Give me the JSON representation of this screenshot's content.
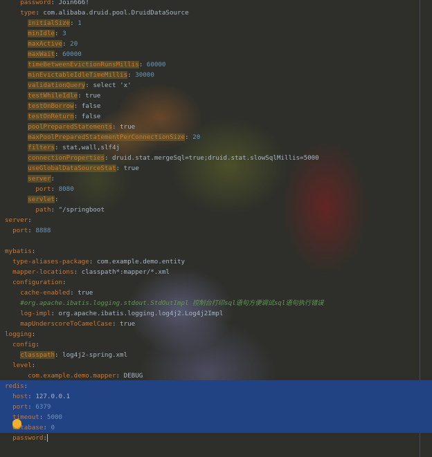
{
  "editor": {
    "lines": [
      {
        "indent": 4,
        "key": "password",
        "value": "Join666!"
      },
      {
        "indent": 4,
        "key": "type",
        "value": "com.alibaba.druid.pool.DruidDataSource"
      },
      {
        "indent": 6,
        "key": "initialSize",
        "value": "1"
      },
      {
        "indent": 6,
        "key": "minIdle",
        "value": "3"
      },
      {
        "indent": 6,
        "key": "maxActive",
        "value": "20"
      },
      {
        "indent": 6,
        "key": "maxWait",
        "value": "60000"
      },
      {
        "indent": 6,
        "key": "timeBetweenEvictionRunsMillis",
        "value": "60000"
      },
      {
        "indent": 6,
        "key": "minEvictableIdleTimeMillis",
        "value": "30000"
      },
      {
        "indent": 6,
        "key": "validationQuery",
        "value": "select 'x'"
      },
      {
        "indent": 6,
        "key": "testWhileIdle",
        "value": "true"
      },
      {
        "indent": 6,
        "key": "testOnBorrow",
        "value": "false"
      },
      {
        "indent": 6,
        "key": "testOnReturn",
        "value": "false"
      },
      {
        "indent": 6,
        "key": "poolPreparedStatements",
        "value": "true"
      },
      {
        "indent": 6,
        "key": "maxPoolPreparedStatementPerConnectionSize",
        "value": "20"
      },
      {
        "indent": 6,
        "key": "filters",
        "value": "stat,wall,slf4j"
      },
      {
        "indent": 6,
        "key": "connectionProperties",
        "value": "druid.stat.mergeSql=true;druid.stat.slowSqlMillis=5000"
      },
      {
        "indent": 6,
        "key": "useGlobalDataSourceStat",
        "value": "true"
      },
      {
        "indent": 6,
        "key": "server",
        "value": ""
      },
      {
        "indent": 8,
        "key": "port",
        "value": "8080"
      },
      {
        "indent": 6,
        "key": "servlet",
        "value": ""
      },
      {
        "indent": 8,
        "key": "path",
        "value": "\"/springboot"
      },
      {
        "indent": 0,
        "key": "server",
        "value": ""
      },
      {
        "indent": 2,
        "key": "port",
        "value": "8888"
      },
      {
        "indent": 0,
        "key": "",
        "value": ""
      },
      {
        "indent": 0,
        "key": "mybatis",
        "value": ""
      },
      {
        "indent": 2,
        "key": "type-aliases-package",
        "value": "com.example.demo.entity"
      },
      {
        "indent": 2,
        "key": "mapper-locations",
        "value": "classpath*:mapper/*.xml"
      },
      {
        "indent": 2,
        "key": "configuration",
        "value": ""
      },
      {
        "indent": 4,
        "key": "cache-enabled",
        "value": "true"
      },
      {
        "indent": 4,
        "comment": "#org.apache.ibatis.logging.stdout.StdOutImpl 控制台打印sql语句方便调试sql语句执行错误"
      },
      {
        "indent": 4,
        "key": "log-impl",
        "value": "org.apache.ibatis.logging.log4j2.Log4j2Impl"
      },
      {
        "indent": 4,
        "key": "mapUnderscoreToCamelCase",
        "value": "true"
      },
      {
        "indent": 0,
        "key": "logging",
        "value": ""
      },
      {
        "indent": 2,
        "key": "config",
        "value": ""
      },
      {
        "indent": 4,
        "key": "classpath",
        "value": "log4j2-spring.xml"
      },
      {
        "indent": 2,
        "key": "level",
        "value": ""
      },
      {
        "indent": 6,
        "key": "com.example.demo.mapper",
        "value": "DEBUG"
      },
      {
        "indent": 0,
        "key": "redis",
        "value": ""
      },
      {
        "indent": 2,
        "key": "host",
        "value": "127.0.0.1"
      },
      {
        "indent": 2,
        "key": "port",
        "value": "6379"
      },
      {
        "indent": 2,
        "key": "timeout",
        "value": "5000"
      },
      {
        "indent": 2,
        "key": "database",
        "value": "0"
      },
      {
        "indent": 2,
        "key": "password",
        "value": ""
      }
    ]
  }
}
